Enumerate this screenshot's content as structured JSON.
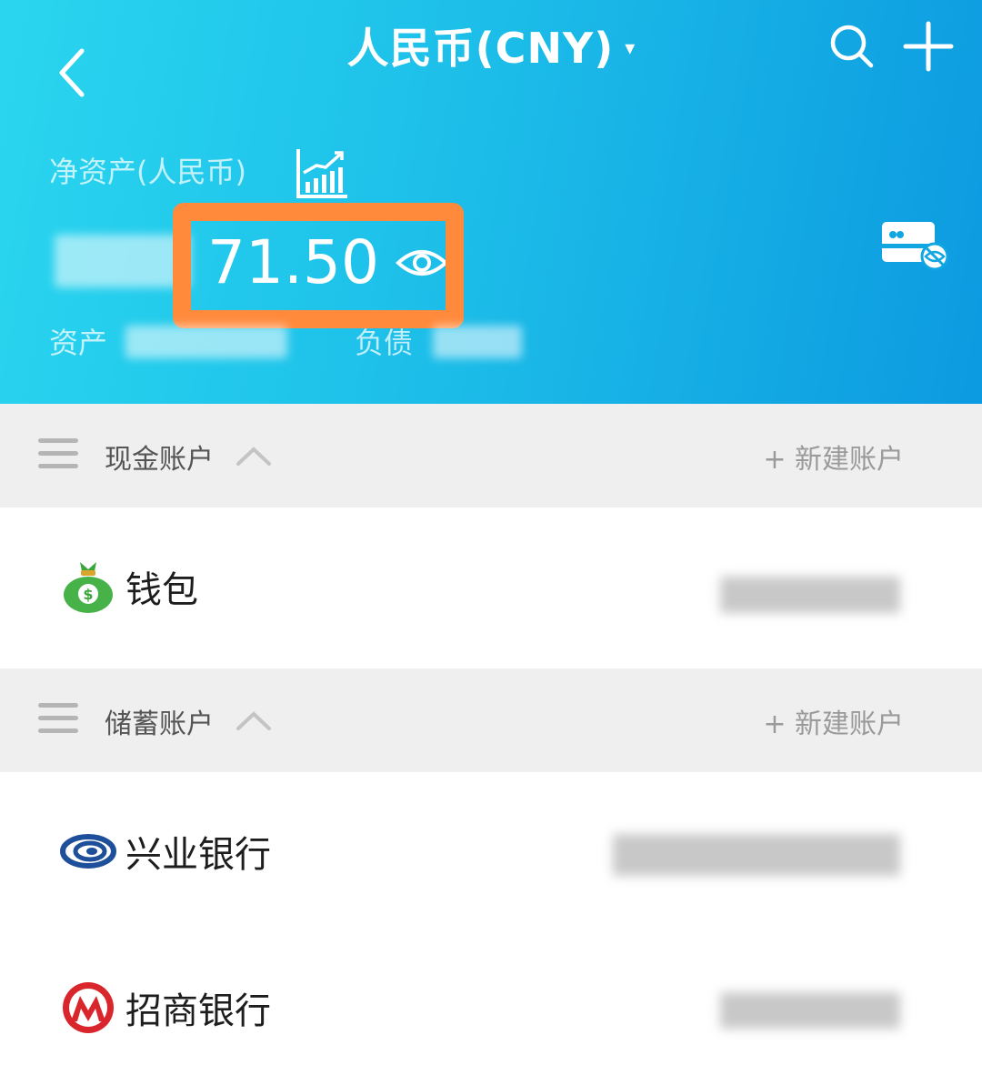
{
  "header": {
    "title": "人民币(CNY)",
    "caret": "▾",
    "net_assets_label": "净资产(人民币)",
    "net_assets_value": "71.50",
    "assets_label": "资产",
    "liabilities_label": "负债"
  },
  "sections": [
    {
      "title": "现金账户",
      "new_account": "+ 新建账户",
      "accounts": [
        {
          "name": "钱包",
          "icon": "money-bag-icon"
        }
      ]
    },
    {
      "title": "储蓄账户",
      "new_account": "+ 新建账户",
      "accounts": [
        {
          "name": "兴业银行",
          "icon": "cib-bank-logo"
        },
        {
          "name": "招商银行",
          "icon": "cmb-bank-logo"
        }
      ]
    }
  ],
  "colors": {
    "header_gradient_start": "#2ad6ef",
    "header_gradient_end": "#0c9ae0",
    "highlight": "#ff8a3c",
    "section_bg": "#efefef"
  }
}
